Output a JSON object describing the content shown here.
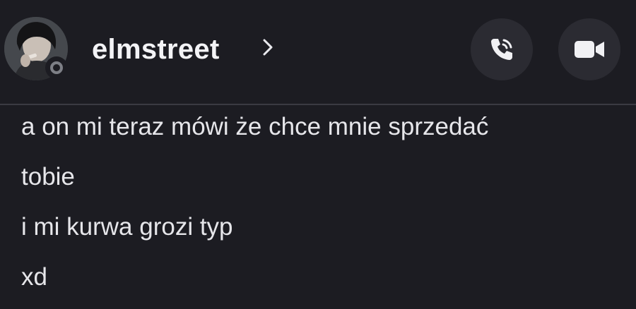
{
  "header": {
    "username": "elmstreet",
    "avatar_icon": "user-avatar",
    "status": "offline",
    "call_icon": "phone-icon",
    "video_icon": "video-camera-icon"
  },
  "colors": {
    "background": "#1c1c22",
    "button_bg": "#2b2b32",
    "divider": "#3a3a42",
    "text": "#e6e6ea",
    "status_offline": "#7d7f86"
  },
  "messages": [
    {
      "text": "a on mi teraz mówi że chce mnie sprzedać"
    },
    {
      "text": "tobie"
    },
    {
      "text": "i mi kurwa grozi typ"
    },
    {
      "text": "xd"
    }
  ]
}
